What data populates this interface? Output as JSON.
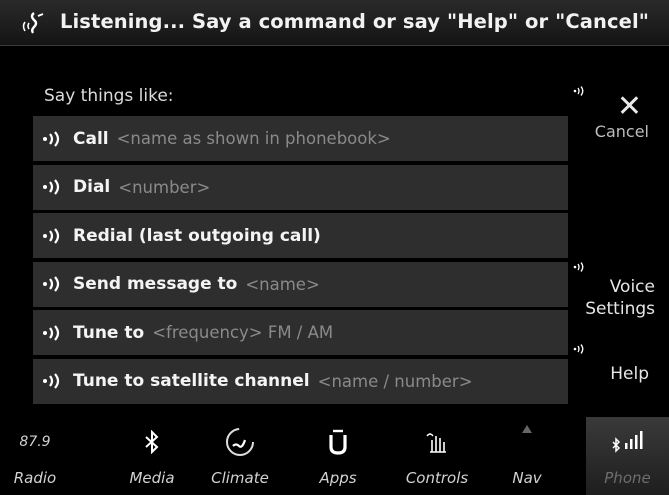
{
  "header": {
    "status_text": "Listening... Say a command or say \"Help\" or \"Cancel\""
  },
  "panel": {
    "intro": "Say things like:",
    "commands": [
      {
        "bold": "Call",
        "bold2": "",
        "hint": "<name as shown in phonebook>"
      },
      {
        "bold": "Dial",
        "bold2": "",
        "hint": "<number>"
      },
      {
        "bold": "Redial (last outgoing call)",
        "bold2": "",
        "hint": ""
      },
      {
        "bold": "Send message to",
        "bold2": "",
        "hint": "<name>"
      },
      {
        "bold": "Tune to",
        "bold2": "",
        "hint": "<frequency> FM / AM"
      },
      {
        "bold": "Tune to satellite channel",
        "bold2": "",
        "hint": "<name / number>"
      }
    ]
  },
  "side": {
    "cancel": {
      "symbol": "✕",
      "label": "Cancel"
    },
    "voice_settings": {
      "line1": "Voice",
      "line2": "Settings"
    },
    "help": {
      "label": "Help"
    }
  },
  "nav": {
    "items": [
      {
        "label": "Radio",
        "icon": "radio-frequency",
        "value": "87.9"
      },
      {
        "label": "Media",
        "icon": "bluetooth-icon"
      },
      {
        "label": "Climate",
        "icon": "climate-icon"
      },
      {
        "label": "Apps",
        "icon": "apps-icon"
      },
      {
        "label": "Controls",
        "icon": "controls-icon"
      },
      {
        "label": "Nav",
        "icon": "nav-icon"
      },
      {
        "label": "Phone",
        "icon": "phone-signal-icon",
        "active": true
      }
    ]
  }
}
